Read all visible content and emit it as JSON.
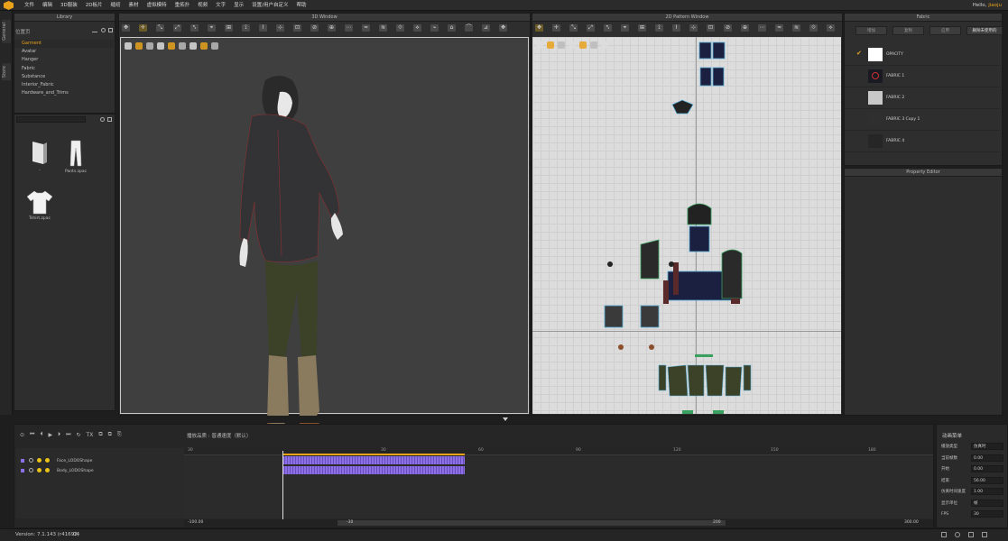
{
  "app": {
    "user_greeting": "Hello,",
    "user_name": "jiaoju"
  },
  "menus": [
    "文件",
    "编辑",
    "3D服装",
    "2D板片",
    "缝纫",
    "素材",
    "虚拟模特",
    "重拓扑",
    "视频",
    "文字",
    "显示",
    "设置/用户自定义",
    "帮助"
  ],
  "side_tabs": [
    "General",
    "Store"
  ],
  "library": {
    "title": "Library",
    "path": "位置页",
    "tree": [
      "Garment",
      "Avatar",
      "Hanger",
      "Fabric",
      "Substance",
      "Interior_Fabric",
      "Hardware_and_Trims"
    ],
    "files": [
      {
        "label": ".."
      },
      {
        "label": "Pants.zpac"
      },
      {
        "label": "Tshirt.zpac"
      }
    ]
  },
  "window3d": {
    "title": "3D Window"
  },
  "pattern": {
    "title": "2D Pattern Window"
  },
  "fabric": {
    "title": "Fabric",
    "buttons": [
      "增加",
      "复制",
      "应用",
      "删除未使用的"
    ],
    "items": [
      {
        "name": "OPACITY",
        "color": "#ffffff",
        "checked": true
      },
      {
        "name": "FABRIC 1",
        "color": "#1a1a22"
      },
      {
        "name": "FABRIC 2",
        "color": "#c8c8c8"
      },
      {
        "name": "FABRIC 3 Copy 1",
        "color": "#2f2f2f"
      },
      {
        "name": "FABRIC 4",
        "color": "#262626"
      }
    ]
  },
  "property_editor": {
    "title": "Property Editor"
  },
  "timeline": {
    "record_label": "播放品质 : 普通速度（默认）",
    "ruler_ticks": [
      "30",
      "30",
      "60",
      "90",
      "120",
      "150",
      "180"
    ],
    "tracks": [
      {
        "name": "Face_LODOShape"
      },
      {
        "name": "Body_LODOShape"
      }
    ],
    "scroll_left": "-100.00",
    "scroll_mid_left": "-30",
    "scroll_mid_right": "200",
    "scroll_right": "300.00"
  },
  "anim_props": {
    "title": "动画菜单",
    "rows": [
      {
        "label": "播放类型",
        "value": "仿真时"
      },
      {
        "label": "当前帧数",
        "value": "0.00"
      },
      {
        "label": "开始",
        "value": "0.00"
      },
      {
        "label": "结束",
        "value": "56.00"
      },
      {
        "label": "仿真时间速度",
        "value": "1.00"
      },
      {
        "label": "显示单位",
        "value": "帧"
      },
      {
        "label": "FPS",
        "value": "30"
      }
    ]
  },
  "status": {
    "version_label": "Version:",
    "version_value": "7.1.143 (r41692)",
    "version_extra": "04"
  },
  "colors": {
    "accent": "#e8a21b",
    "keyframe_bar": "#8c6fe6"
  }
}
